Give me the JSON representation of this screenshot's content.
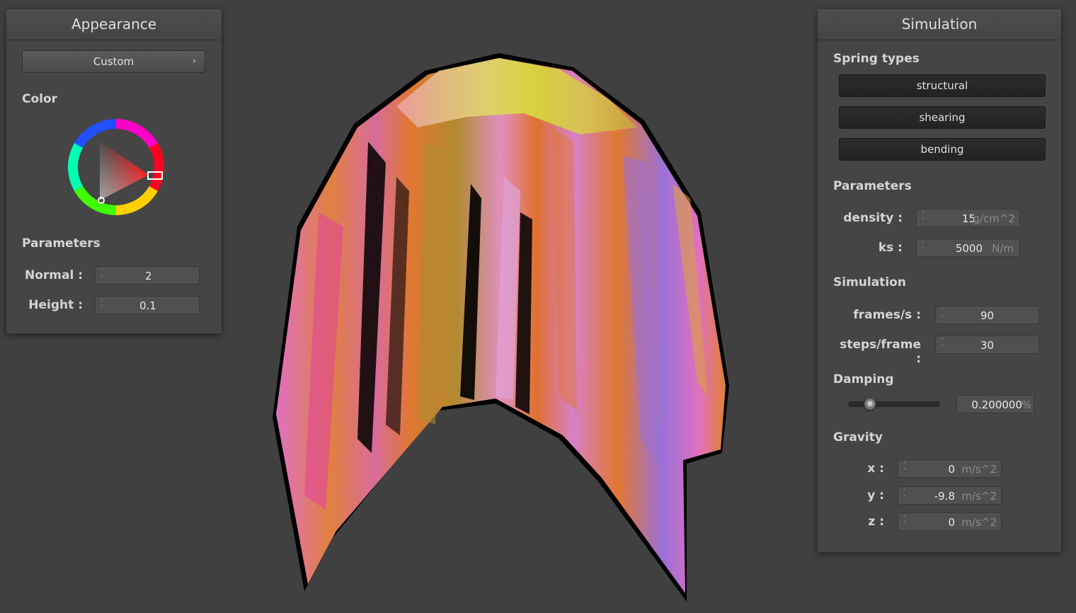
{
  "appearance": {
    "title": "Appearance",
    "preset_label": "Custom",
    "preset_chevron": "›",
    "color_label": "Color",
    "parameters_label": "Parameters",
    "normal_label": "Normal :",
    "normal_value": "2",
    "height_label": "Height :",
    "height_value": "0.1",
    "selected_hue": "#ff0000"
  },
  "simulation": {
    "title": "Simulation",
    "spring_types_label": "Spring types",
    "spring_types": [
      "structural",
      "shearing",
      "bending"
    ],
    "parameters_label": "Parameters",
    "density_label": "density :",
    "density_value": "15",
    "density_unit": "g/cm^2",
    "ks_label": "ks :",
    "ks_value": "5000",
    "ks_unit": "N/m",
    "simulation_label": "Simulation",
    "fps_label": "frames/s :",
    "fps_value": "90",
    "steps_label": "steps/frame :",
    "steps_value": "30",
    "damping_label": "Damping",
    "damping_value": "0.200000",
    "damping_unit": "%",
    "damping_slider_level": 0.2,
    "gravity_label": "Gravity",
    "gx_label": "x :",
    "gx_value": "0",
    "gy_label": "y :",
    "gy_value": "-9.8",
    "gz_label": "z :",
    "gz_value": "0",
    "gravity_unit": "m/s^2"
  },
  "icons": [
    "spinner-arrows-icon",
    "chevron-right-icon",
    "slider-knob-icon"
  ],
  "colors": {
    "background": "#404040",
    "panel": "#454545",
    "cloth_pink": "#e070c0",
    "cloth_orange": "#e07830",
    "cloth_yellow": "#d8d040",
    "cloth_violet": "#9a70d8"
  }
}
